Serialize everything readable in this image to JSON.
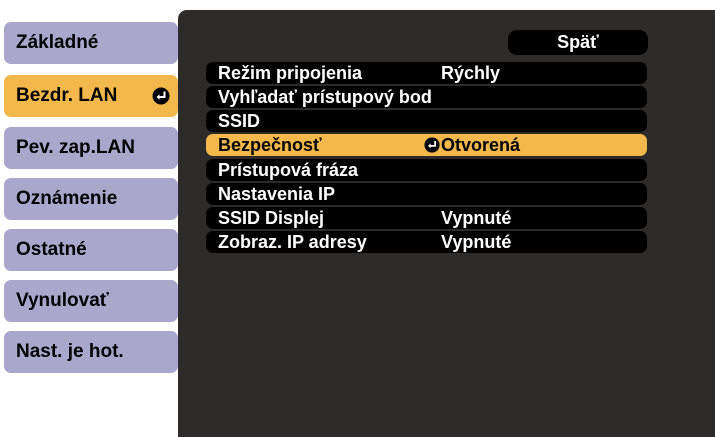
{
  "sidebar": {
    "items": [
      {
        "label": "Základné"
      },
      {
        "label": "Bezdr. LAN",
        "icon": "enter-icon"
      },
      {
        "label": "Pev. zap.LAN"
      },
      {
        "label": "Oznámenie"
      },
      {
        "label": "Ostatné"
      },
      {
        "label": "Vynulovať"
      },
      {
        "label": "Nast. je hot."
      }
    ],
    "active_color": "#f3b84b",
    "inactive_color": "#a9a8cc"
  },
  "panel": {
    "back_label": "Späť",
    "rows": [
      {
        "label": "Režim pripojenia",
        "value": "Rýchly"
      },
      {
        "label": "Vyhľadať prístupový bod",
        "value": ""
      },
      {
        "label": "SSID",
        "value": ""
      },
      {
        "label": "Bezpečnosť",
        "value": "Otvorená",
        "icon": "enter-icon"
      },
      {
        "label": "Prístupová fráza",
        "value": ""
      },
      {
        "label": "Nastavenia IP",
        "value": ""
      },
      {
        "label": "SSID Displej",
        "value": "Vypnuté"
      },
      {
        "label": "Zobraz. IP adresy",
        "value": "Vypnuté"
      }
    ],
    "background_color": "#2d2b2a",
    "highlight_color": "#f3b84b"
  }
}
